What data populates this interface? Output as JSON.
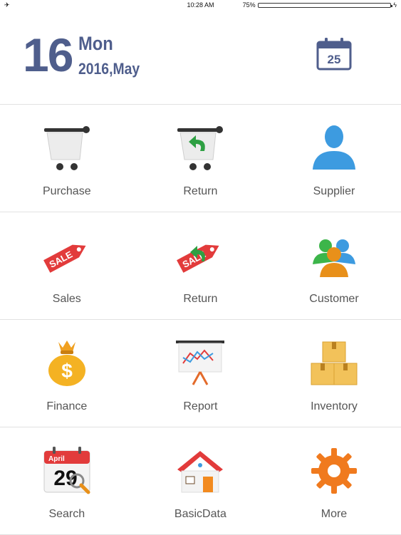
{
  "status": {
    "airplane_icon": "airplane-icon",
    "time": "10:28 AM",
    "battery": "75%",
    "battery_level": 0.75
  },
  "date": {
    "day": "16",
    "weekday": "Mon",
    "year_month": "2016,May",
    "calendar_day": "25"
  },
  "tiles": [
    {
      "label": "Purchase",
      "icon": "cart-icon"
    },
    {
      "label": "Return",
      "icon": "cart-return-icon"
    },
    {
      "label": "Supplier",
      "icon": "person-icon"
    },
    {
      "label": "Sales",
      "icon": "sale-tag-icon",
      "tag": "SALE"
    },
    {
      "label": "Return",
      "icon": "sale-tag-return-icon",
      "tag": "SALE"
    },
    {
      "label": "Customer",
      "icon": "people-icon"
    },
    {
      "label": "Finance",
      "icon": "money-bag-icon"
    },
    {
      "label": "Report",
      "icon": "chart-board-icon"
    },
    {
      "label": "Inventory",
      "icon": "boxes-icon"
    },
    {
      "label": "Search",
      "icon": "calendar-search-icon",
      "month": "April",
      "num": "29"
    },
    {
      "label": "BasicData",
      "icon": "house-icon"
    },
    {
      "label": "More",
      "icon": "gear-icon"
    }
  ],
  "colors": {
    "accent": "#4f5e8c",
    "divider": "#e2e2e2",
    "label": "#555555"
  }
}
